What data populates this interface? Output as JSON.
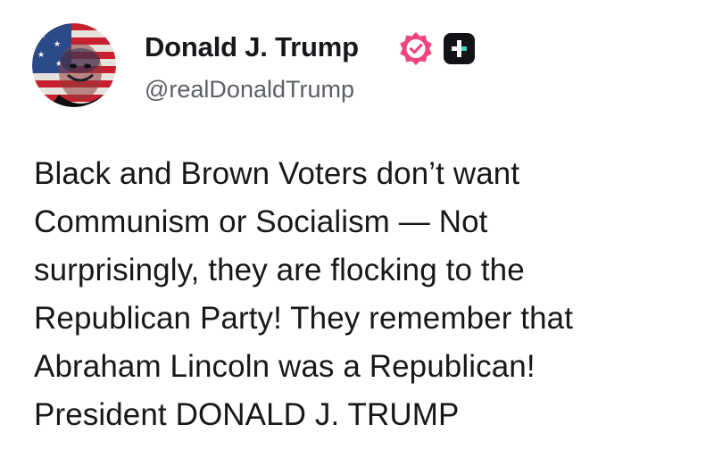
{
  "post": {
    "author": {
      "display_name": "Donald J. Trump",
      "handle": "@realDonaldTrump",
      "verified_badge_icon": "verified-badge-icon",
      "verified_badge_color": "#f0467f",
      "app_icon": "truth-social-app-icon",
      "avatar_icon": "flag-portrait-avatar"
    },
    "body": "Black and Brown Voters don’t want\nCommunism or Socialism — Not\nsurprisingly, they are flocking to the\nRepublican Party! They remember that\nAbraham Lincoln was a Republican!\nPresident DONALD J. TRUMP"
  },
  "colors": {
    "text": "#16181c",
    "secondary_text": "#5b5f66",
    "background": "#ffffff"
  }
}
